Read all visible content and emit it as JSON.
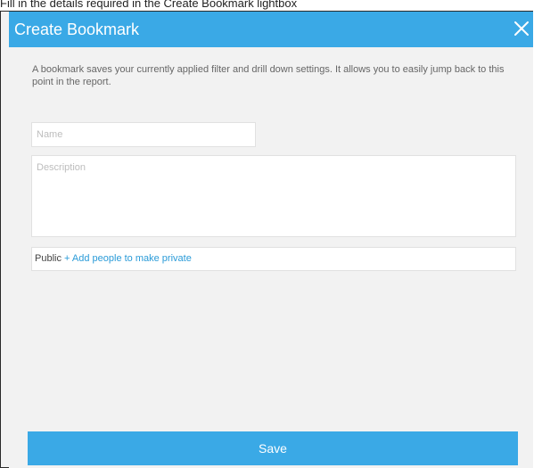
{
  "caption": "Fill in the details required in the Create Bookmark lightbox",
  "dialog": {
    "title": "Create Bookmark",
    "intro": "A bookmark saves your currently applied filter and drill down settings. It allows you to easily jump back to this point in the report.",
    "name_field": {
      "value": "",
      "placeholder": "Name"
    },
    "description_field": {
      "value": "",
      "placeholder": "Description"
    },
    "access": {
      "label": "Public",
      "link_text": "+ Add people to make private"
    },
    "save_label": "Save"
  },
  "colors": {
    "accent": "#3aa9e6",
    "link": "#2a9bd8",
    "panel_bg": "#f2f2f2"
  },
  "icons": {
    "close": "close-icon"
  }
}
